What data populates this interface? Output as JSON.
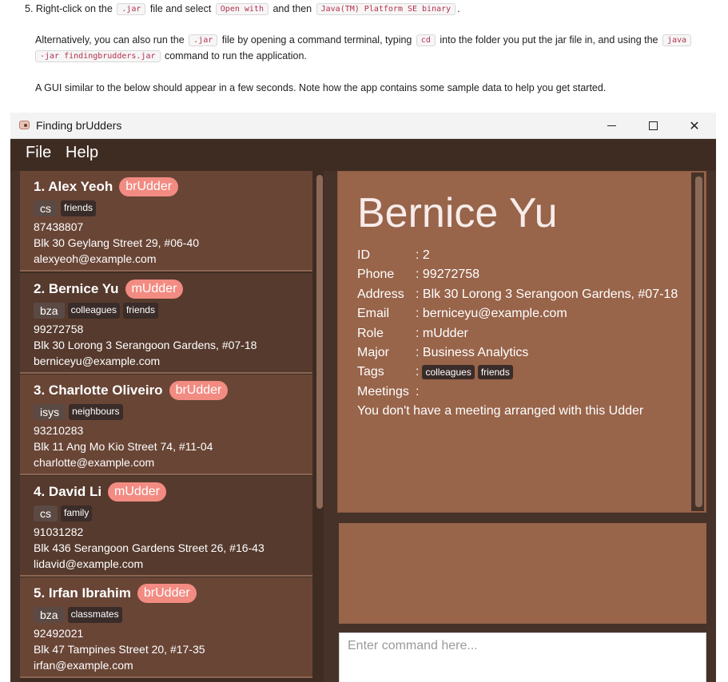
{
  "doc": {
    "step_number": "5.",
    "step_text_1": "Right-click on the",
    "jar_code": ".jar",
    "step_text_2": "file and select",
    "open_with_code": "Open with",
    "step_text_3": "and then",
    "java_binary_code": "Java(TM) Platform SE binary",
    "step_text_4": ".",
    "alt_text_1": "Alternatively, you can also run the",
    "alt_jar_code": ".jar",
    "alt_text_2": "file by opening a command terminal, typing",
    "cd_code": "cd",
    "alt_text_3": "into the folder you put the jar file in, and using the",
    "java_code_part1": "java",
    "java_code_part2": "-jar findingbrudders.jar",
    "alt_text_4": "command to run the application.",
    "gui_text": "A GUI similar to the below should appear in a few seconds. Note how the app contains some sample data to help you get started."
  },
  "window": {
    "title": "Finding brUdders",
    "min_symbol": "",
    "max_symbol": "",
    "close_symbol": "✕"
  },
  "menu": {
    "file": "File",
    "help": "Help"
  },
  "persons": [
    {
      "index": "1.",
      "name": "Alex Yeoh",
      "role": "brUdder",
      "major": "cs",
      "tags": [
        "friends"
      ],
      "phone": "87438807",
      "address": "Blk 30 Geylang Street 29, #06-40",
      "email": "alexyeoh@example.com"
    },
    {
      "index": "2.",
      "name": "Bernice Yu",
      "role": "mUdder",
      "major": "bza",
      "tags": [
        "colleagues",
        "friends"
      ],
      "phone": "99272758",
      "address": "Blk 30 Lorong 3 Serangoon Gardens, #07-18",
      "email": "berniceyu@example.com"
    },
    {
      "index": "3.",
      "name": "Charlotte Oliveiro",
      "role": "brUdder",
      "major": "isys",
      "tags": [
        "neighbours"
      ],
      "phone": "93210283",
      "address": "Blk 11 Ang Mo Kio Street 74, #11-04",
      "email": "charlotte@example.com"
    },
    {
      "index": "4.",
      "name": "David Li",
      "role": "mUdder",
      "major": "cs",
      "tags": [
        "family"
      ],
      "phone": "91031282",
      "address": "Blk 436 Serangoon Gardens Street 26, #16-43",
      "email": "lidavid@example.com"
    },
    {
      "index": "5.",
      "name": "Irfan Ibrahim",
      "role": "brUdder",
      "major": "bza",
      "tags": [
        "classmates"
      ],
      "phone": "92492021",
      "address": "Blk 47 Tampines Street 20, #17-35",
      "email": "irfan@example.com"
    }
  ],
  "detail": {
    "name": "Bernice Yu",
    "labels": {
      "id": "ID",
      "phone": "Phone",
      "address": "Address",
      "email": "Email",
      "role": "Role",
      "major": "Major",
      "tags": "Tags",
      "meetings": "Meetings"
    },
    "id": ": 2",
    "phone": ": 99272758",
    "address": ": Blk 30 Lorong 3 Serangoon Gardens, #07-18",
    "email": ": berniceyu@example.com",
    "role": ": mUdder",
    "major": ": Business Analytics",
    "tags_prefix": ":",
    "tags": [
      "colleagues",
      "friends"
    ],
    "meetings_prefix": ":",
    "meeting_note": "You don't have a meeting arranged with this Udder"
  },
  "command": {
    "placeholder": "Enter command here...",
    "value": ""
  },
  "colors": {
    "window_bg": "#463228",
    "card_odd": "#694536",
    "card_even": "#563a2d",
    "role_badge": "#f28b82",
    "detail_bg": "#98644a"
  }
}
